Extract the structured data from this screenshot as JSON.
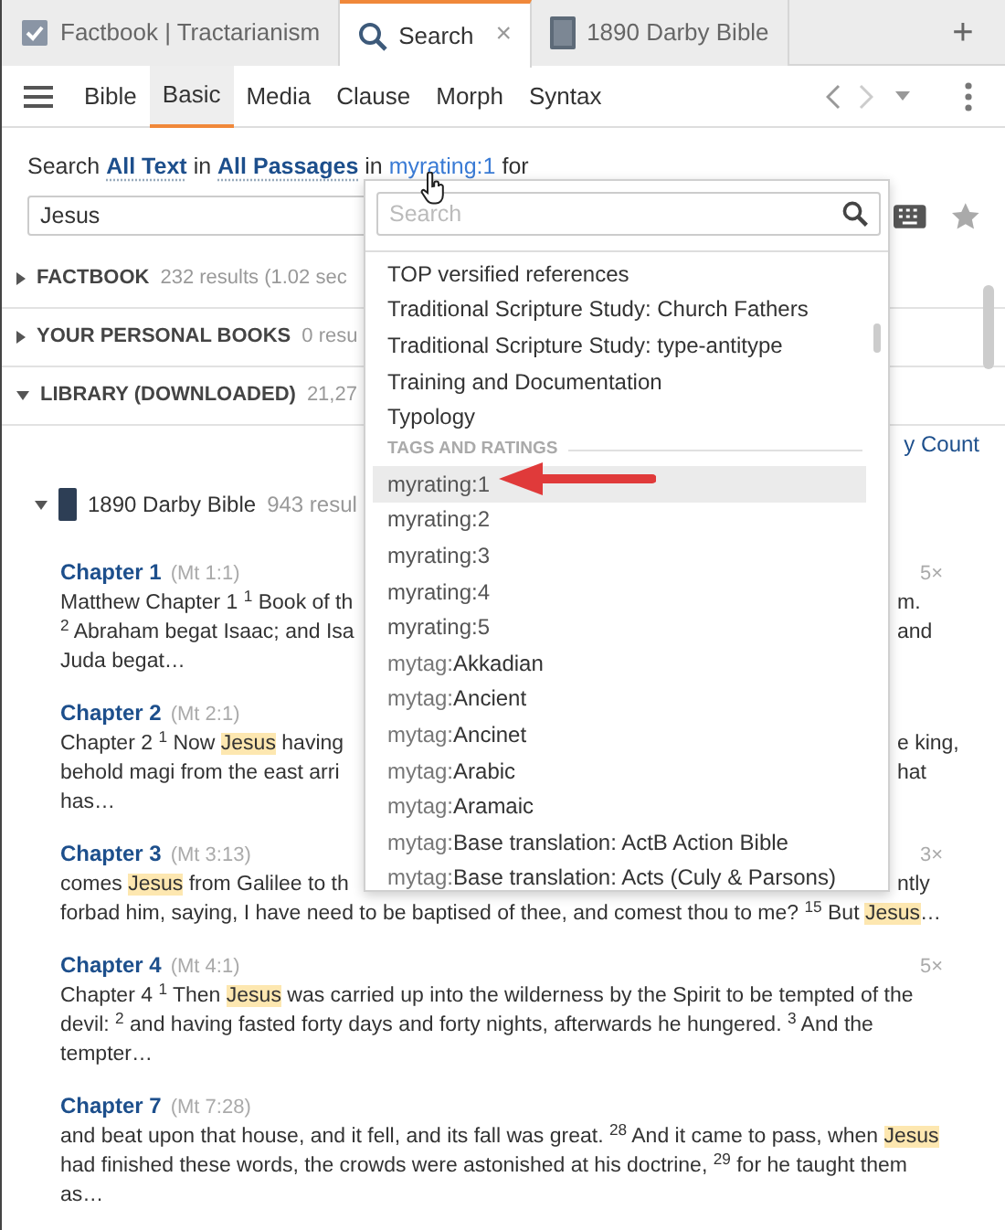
{
  "tabs": [
    {
      "label": "Factbook | Tractarianism",
      "selected": false
    },
    {
      "label": "Search",
      "selected": true,
      "close": "×"
    },
    {
      "label": "1890 Darby Bible",
      "selected": false
    }
  ],
  "new_tab": "+",
  "search_types": [
    {
      "label": "Bible",
      "selected": false
    },
    {
      "label": "Basic",
      "selected": true
    },
    {
      "label": "Media",
      "selected": false
    },
    {
      "label": "Clause",
      "selected": false
    },
    {
      "label": "Morph",
      "selected": false
    },
    {
      "label": "Syntax",
      "selected": false
    }
  ],
  "search_line": [
    {
      "kind": "text",
      "text": "Search"
    },
    {
      "kind": "option",
      "text": "All Text"
    },
    {
      "kind": "text",
      "text": "in"
    },
    {
      "kind": "option",
      "text": "All Passages"
    },
    {
      "kind": "text",
      "text": "in"
    },
    {
      "kind": "filter",
      "text": "myrating:1"
    },
    {
      "kind": "text",
      "text": "for"
    }
  ],
  "query": {
    "value": "Jesus"
  },
  "sections": [
    {
      "title": "FACTBOOK",
      "summary": "232 results (1.02 sec",
      "expanded": false
    },
    {
      "title": "YOUR PERSONAL BOOKS",
      "summary": "0 resu",
      "expanded": false
    },
    {
      "title": "LIBRARY (DOWNLOADED)",
      "summary": "21,27",
      "expanded": true
    }
  ],
  "sort_link": "y Count",
  "book": {
    "title": "1890 Darby Bible",
    "summary": "943 resul",
    "expanded": true
  },
  "results": [
    {
      "chapter": "Chapter 1",
      "ref": "(Mt 1:1)",
      "count": "5×",
      "lines": [
        {
          "left": "Matthew Chapter 1 $^{1}$ Book of th",
          "right": "m."
        },
        {
          "left": "$^{2}$ Abraham begat Isaac; and Isa",
          "right": "and"
        },
        {
          "left": "Juda begat…"
        }
      ]
    },
    {
      "chapter": "Chapter 2",
      "ref": "(Mt 2:1)",
      "lines": [
        {
          "left": [
            {
              "text": "Chapter 2 $^{1}$ Now ",
              "highlighted": false
            },
            {
              "text": "Jesus",
              "highlighted": true
            },
            {
              "text": " having",
              "highlighted": false
            }
          ],
          "right": "e king,"
        },
        {
          "left": "behold magi from the east arri",
          "right": "hat"
        },
        {
          "left": "has…"
        }
      ]
    },
    {
      "chapter": "Chapter 3",
      "ref": "(Mt 3:13)",
      "count": "3×",
      "lines": [
        {
          "left": [
            {
              "text": "comes ",
              "highlighted": false
            },
            {
              "text": "Jesus",
              "highlighted": true
            },
            {
              "text": " from Galilee to th",
              "highlighted": false
            }
          ],
          "right": "ntly"
        },
        {
          "text": [
            {
              "text": "forbad him, saying, I have need to be baptised of thee, and comest thou to me? $^{15}$ But ",
              "highlighted": false
            },
            {
              "text": "Jesus",
              "highlighted": true
            },
            {
              "text": "…",
              "highlighted": false
            }
          ]
        }
      ]
    },
    {
      "chapter": "Chapter 4",
      "ref": "(Mt 4:1)",
      "count": "5×",
      "lines": [
        {
          "text": [
            {
              "text": "Chapter 4 $^{1}$ Then ",
              "highlighted": false
            },
            {
              "text": "Jesus",
              "highlighted": true
            },
            {
              "text": " was carried up into the wilderness by the Spirit to be tempted of the devil: $^{2}$ and having fasted forty days and forty nights, afterwards he hungered. $^{3}$ And the tempter…",
              "highlighted": false
            }
          ]
        }
      ]
    },
    {
      "chapter": "Chapter 7",
      "ref": "(Mt 7:28)",
      "lines": [
        {
          "text": [
            {
              "text": "and beat upon that house, and it fell, and its fall was great. $^{28}$ And it came to pass, when ",
              "highlighted": false
            },
            {
              "text": "Jesus",
              "highlighted": true
            },
            {
              "text": " had finished these words, the crowds were astonished at his doctrine, $^{29}$ for he taught them as…",
              "highlighted": false
            }
          ]
        }
      ]
    }
  ],
  "dropdown": {
    "placeholder": "Search",
    "items": [
      {
        "kind": "item",
        "label": "TOP versified references",
        "selected": false
      },
      {
        "kind": "item",
        "label": "Traditional Scripture Study: Church Fathers",
        "selected": false
      },
      {
        "kind": "item",
        "label": "Traditional Scripture Study: type-antitype",
        "selected": false
      },
      {
        "kind": "item",
        "label": "Training and Documentation",
        "selected": false
      },
      {
        "kind": "item",
        "label": "Typology",
        "selected": false
      },
      {
        "kind": "header",
        "label": "TAGS AND RATINGS"
      },
      {
        "kind": "rating",
        "label": "myrating:1",
        "selected": true
      },
      {
        "kind": "rating",
        "label": "myrating:2",
        "selected": false
      },
      {
        "kind": "rating",
        "label": "myrating:3",
        "selected": false
      },
      {
        "kind": "rating",
        "label": "myrating:4",
        "selected": false
      },
      {
        "kind": "rating",
        "label": "myrating:5",
        "selected": false
      },
      {
        "kind": "tag",
        "prefix": "mytag:",
        "label": "Akkadian",
        "selected": false
      },
      {
        "kind": "tag",
        "prefix": "mytag:",
        "label": "Ancient",
        "selected": false
      },
      {
        "kind": "tag",
        "prefix": "mytag:",
        "label": "Ancinet",
        "selected": false
      },
      {
        "kind": "tag",
        "prefix": "mytag:",
        "label": "Arabic",
        "selected": false
      },
      {
        "kind": "tag",
        "prefix": "mytag:",
        "label": "Aramaic",
        "selected": false
      },
      {
        "kind": "tag",
        "prefix": "mytag:",
        "label": "Base translation: ActB Action Bible",
        "selected": false
      },
      {
        "kind": "tag",
        "prefix": "mytag:",
        "label": "Base translation: Acts (Culy & Parsons)",
        "selected": false
      }
    ]
  }
}
